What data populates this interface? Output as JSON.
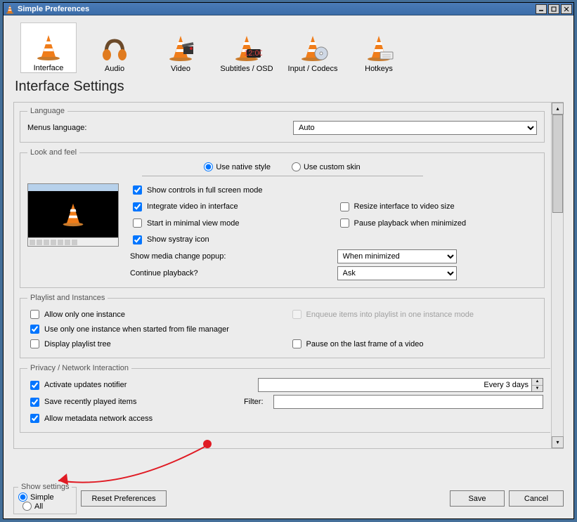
{
  "window": {
    "title": "Simple Preferences"
  },
  "tabs": [
    "Interface",
    "Audio",
    "Video",
    "Subtitles / OSD",
    "Input / Codecs",
    "Hotkeys"
  ],
  "selected_tab_index": 0,
  "heading": "Interface Settings",
  "language": {
    "legend": "Language",
    "label": "Menus language:",
    "value": "Auto"
  },
  "look": {
    "legend": "Look and feel",
    "opt_native": "Use native style",
    "opt_skin": "Use custom skin",
    "cb_full": "Show controls in full screen mode",
    "cb_integrate": "Integrate video in interface",
    "cb_minimal": "Start in minimal view mode",
    "cb_systray": "Show systray icon",
    "cb_resize": "Resize interface to video size",
    "cb_pause": "Pause playback when minimized",
    "lbl_popup": "Show media change popup:",
    "val_popup": "When minimized",
    "lbl_continue": "Continue playback?",
    "val_continue": "Ask"
  },
  "playlist": {
    "legend": "Playlist and Instances",
    "cb_one": "Allow only one instance",
    "cb_filemgr": "Use only one instance when started from file manager",
    "cb_tree": "Display playlist tree",
    "cb_enqueue": "Enqueue items into playlist in one instance mode",
    "cb_lastframe": "Pause on the last frame of a video"
  },
  "privacy": {
    "legend": "Privacy / Network Interaction",
    "cb_upd": "Activate updates notifier",
    "val_upd": "Every 3 days",
    "cb_recent": "Save recently played items",
    "lbl_filter": "Filter:",
    "val_filter": "",
    "cb_meta": "Allow metadata network access"
  },
  "footer": {
    "show_legend": "Show settings",
    "opt_simple": "Simple",
    "opt_all": "All",
    "btn_reset": "Reset Preferences",
    "btn_save": "Save",
    "btn_cancel": "Cancel"
  },
  "annotation": {
    "dot_color": "#e01b24",
    "arrow_color": "#e01b24"
  }
}
